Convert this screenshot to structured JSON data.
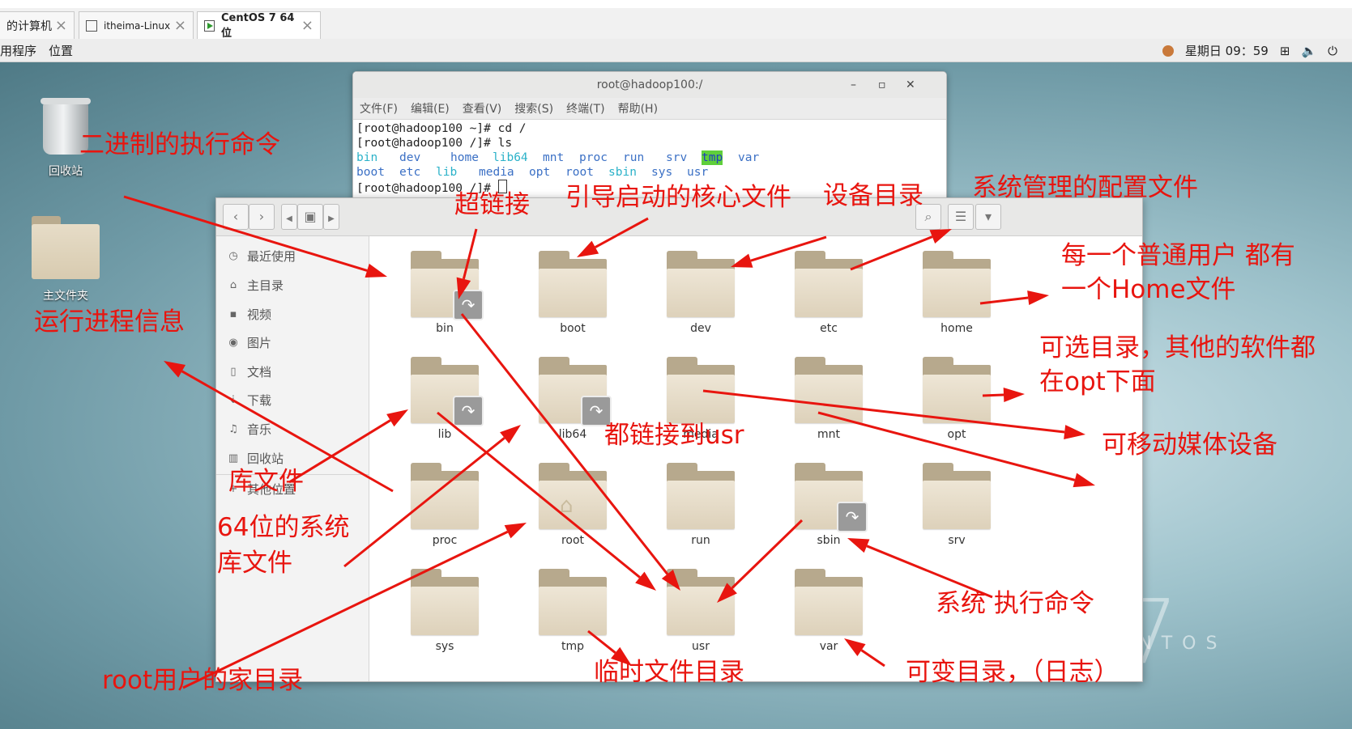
{
  "vm_tabs": [
    {
      "label": "的计算机",
      "active": false
    },
    {
      "label": "itheima-Linux",
      "active": false
    },
    {
      "label": "CentOS 7 64 位",
      "active": true
    }
  ],
  "gnome_bar": {
    "menu_apps": "用程序",
    "menu_places": "位置",
    "clock": "星期日 09：59"
  },
  "desktop": {
    "trash_label": "回收站",
    "home_label": "主文件夹",
    "centos_text": "CENTOS",
    "centos_number": "7"
  },
  "terminal": {
    "title": "root@hadoop100:/",
    "menu": [
      "文件(F)",
      "编辑(E)",
      "查看(V)",
      "搜索(S)",
      "终端(T)",
      "帮助(H)"
    ],
    "lines": [
      "[root@hadoop100 ~]# cd /",
      "[root@hadoop100 /]# ls"
    ],
    "ls_row1": [
      "bin",
      "dev",
      "home",
      "lib64",
      "mnt",
      "proc",
      "run",
      "srv",
      "tmp",
      "var"
    ],
    "ls_row2": [
      "boot",
      "etc",
      "lib",
      "media",
      "opt",
      "root",
      "sbin",
      "sys",
      "usr"
    ],
    "prompt": "[root@hadoop100 /]# "
  },
  "file_manager": {
    "sidebar": [
      "最近使用",
      "主目录",
      "视频",
      "图片",
      "文档",
      "下载",
      "音乐",
      "回收站",
      "其他位置"
    ],
    "folders": [
      {
        "name": "bin",
        "link": true
      },
      {
        "name": "boot",
        "link": false
      },
      {
        "name": "dev",
        "link": false
      },
      {
        "name": "etc",
        "link": false
      },
      {
        "name": "home",
        "link": false
      },
      {
        "name": "lib",
        "link": true
      },
      {
        "name": "lib64",
        "link": true
      },
      {
        "name": "media",
        "link": false
      },
      {
        "name": "mnt",
        "link": false
      },
      {
        "name": "opt",
        "link": false
      },
      {
        "name": "proc",
        "link": false
      },
      {
        "name": "root",
        "link": false
      },
      {
        "name": "run",
        "link": false
      },
      {
        "name": "sbin",
        "link": true
      },
      {
        "name": "srv",
        "link": false
      },
      {
        "name": "sys",
        "link": false
      },
      {
        "name": "tmp",
        "link": false
      },
      {
        "name": "usr",
        "link": false
      },
      {
        "name": "var",
        "link": false
      }
    ]
  },
  "annotations": {
    "bin": "二进制的执行命令",
    "link": "超链接",
    "boot": "引导启动的核心文件",
    "dev": "设备目录",
    "etc": "系统管理的配置文件",
    "home_1": "每一个普通用户 都有",
    "home_2": "一个Home文件",
    "proc": "运行进程信息",
    "opt_1": "可选目录，其他的软件都",
    "opt_2": "在opt下面",
    "usr": "都链接到usr",
    "media": "可移动媒体设备",
    "lib": "库文件",
    "lib64_1": "64位的系统",
    "lib64_2": "库文件",
    "sbin": "系统 执行命令",
    "root": "root用户的家目录",
    "tmp": "临时文件目录",
    "var": "可变目录，（日志）"
  },
  "colors": {
    "annotation": "#e8150f",
    "folder": "#ddd1ba",
    "tmp_highlight": "#5fcf3b",
    "dir_blue": "#3b70c5",
    "link_cyan": "#2bb2c9"
  }
}
